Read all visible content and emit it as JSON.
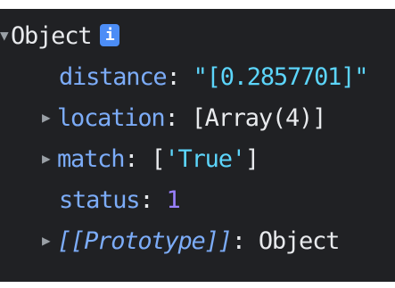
{
  "object_header": {
    "label": "Object",
    "info_badge": "i"
  },
  "properties": [
    {
      "key": "distance",
      "separator": ": ",
      "value": "\"[0.2857701]\"",
      "type": "string",
      "expandable": false
    },
    {
      "key": "location",
      "separator": ": ",
      "value": "[Array(4)]",
      "type": "array",
      "expandable": true
    },
    {
      "key": "match",
      "separator": ": ",
      "value_open": "[",
      "value_inner": "'True'",
      "value_close": "]",
      "type": "array-inline",
      "expandable": true
    },
    {
      "key": "status",
      "separator": ": ",
      "value": "1",
      "type": "number",
      "expandable": false
    },
    {
      "key": "[[Prototype]]",
      "separator": ": ",
      "value": "Object",
      "type": "prototype",
      "expandable": true
    }
  ],
  "icons": {
    "expanded": "triangle-down-icon",
    "collapsed": "triangle-right-icon"
  },
  "colors": {
    "background": "#202124",
    "key": "#7cacf8",
    "string": "#5cd5fb",
    "number": "#9980ff",
    "default_text": "#e8eaed",
    "badge": "#4c8df6"
  }
}
